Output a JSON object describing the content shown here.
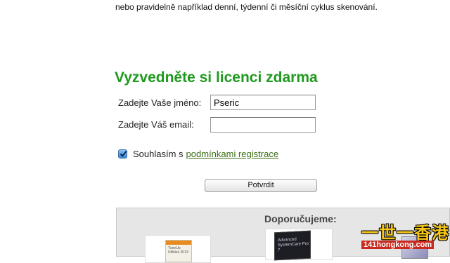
{
  "intro": {
    "text": "nebo pravidelně například denní, týdenní či měsíční cyklus skenování."
  },
  "form": {
    "heading": "Vyzvedněte si licenci zdarma",
    "name_label": "Zadejte Vaše jméno:",
    "name_value": "Pseric",
    "email_label": "Zadejte Váš email:",
    "email_value": "",
    "agree_checked": true,
    "agree_text": "Souhlasím s",
    "agree_link": "podmínkami registrace",
    "submit_label": "Potvrdit"
  },
  "recommend": {
    "title": "Doporučujeme:",
    "products": [
      {
        "box_text": "TuneUp Utilities 2013",
        "icon": "tuneup-box-icon"
      },
      {
        "box_text": "Advanced SystemCare Pro 7",
        "icon": "systemcare-box-icon"
      },
      {
        "icon": "product-box-icon"
      }
    ]
  },
  "watermark": {
    "top": "一世一香港",
    "bottom": "141hongkong.com"
  },
  "colors": {
    "heading": "#1f9a1f",
    "link": "#3a6d12",
    "panel": "#e6e6e6"
  }
}
